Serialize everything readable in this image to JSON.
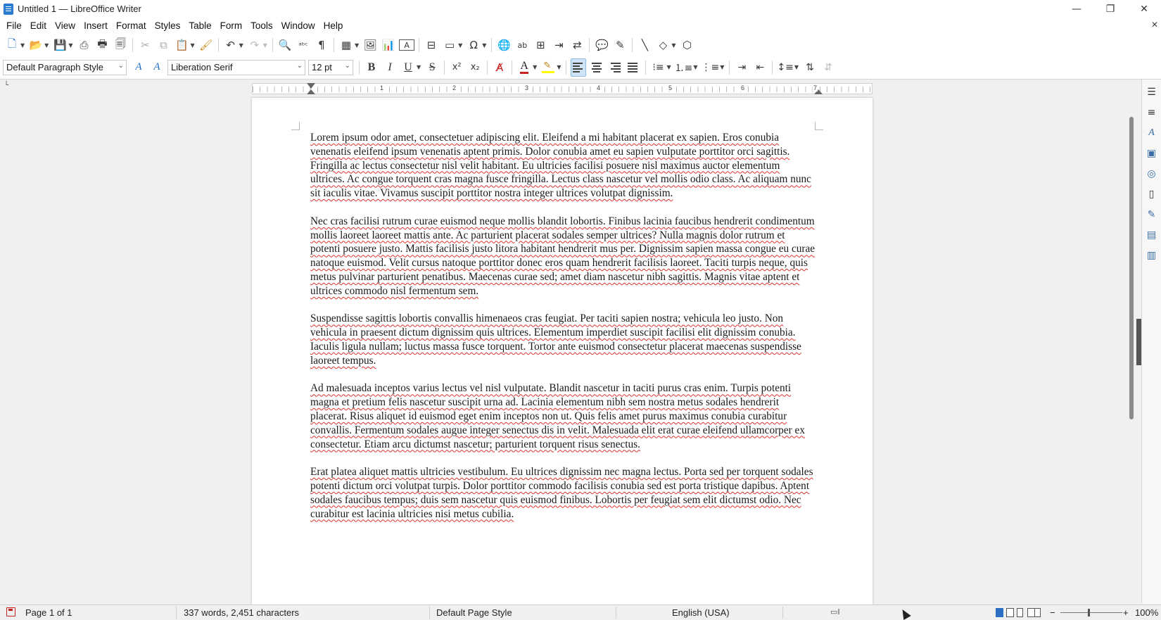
{
  "window": {
    "title": "Untitled 1 — LibreOffice Writer",
    "controls": {
      "minimize": "—",
      "restore": "❐",
      "close": "✕"
    }
  },
  "menu": {
    "items": [
      "File",
      "Edit",
      "View",
      "Insert",
      "Format",
      "Styles",
      "Table",
      "Form",
      "Tools",
      "Window",
      "Help"
    ],
    "close_doc": "✕"
  },
  "toolbar_standard": {
    "icons": {
      "new": "🗋",
      "open": "📂",
      "save": "💾",
      "export_pdf": "⎙",
      "print": "🖶",
      "print_preview": "🗐",
      "cut": "✂",
      "copy": "⧉",
      "paste": "📋",
      "clone": "🖌",
      "undo": "↶",
      "redo": "↷",
      "find_replace": "🔍",
      "spelling": "ᵃᵇᶜ",
      "formatting_marks": "¶",
      "table": "▦",
      "image": "🖼",
      "chart": "📊",
      "textbox": "A",
      "page_break": "⊟",
      "field": "▭",
      "special_char": "Ω",
      "hyperlink": "🌐",
      "footnote": "ab",
      "endnote": "⊞",
      "bookmark": "⇥",
      "cross_ref": "⇄",
      "comment": "💬",
      "track_changes": "✎",
      "line": "╲",
      "shapes": "◇",
      "draw": "⬡"
    }
  },
  "toolbar_formatting": {
    "paragraph_style": "Default Paragraph Style",
    "font_name": "Liberation Serif",
    "font_size": "12 pt",
    "bold": "B",
    "italic": "I",
    "underline": "U",
    "strikethrough": "S",
    "superscript": "x²",
    "subscript": "x₂",
    "clear_formatting": "A̸",
    "font_color": "A",
    "update_style": "A",
    "new_style": "A"
  },
  "ruler": {
    "numbers": [
      "1",
      "2",
      "3",
      "4",
      "5",
      "6",
      "7"
    ],
    "corner": "└"
  },
  "document": {
    "paragraphs": [
      "Lorem ipsum odor amet, consectetuer adipiscing elit. Eleifend a mi habitant placerat ex sapien. Eros conubia venenatis eleifend ipsum venenatis aptent primis. Dolor conubia amet eu sapien vulputate porttitor orci sagittis. Fringilla ac lectus consectetur nisl velit habitant. Eu ultricies facilisi posuere nisl maximus auctor elementum ultrices. Ac congue torquent cras magna fusce fringilla. Lectus class nascetur vel mollis odio class. Ac aliquam nunc sit iaculis vitae. Vivamus suscipit porttitor nostra integer ultrices volutpat dignissim.",
      "Nec cras facilisi rutrum curae euismod neque mollis blandit lobortis. Finibus lacinia faucibus hendrerit condimentum mollis laoreet laoreet mattis ante. Ac parturient placerat sodales semper ultrices? Nulla magnis dolor rutrum et potenti posuere justo. Mattis facilisis justo litora habitant hendrerit mus per. Dignissim sapien massa congue eu curae natoque euismod. Velit cursus natoque porttitor donec eros quam hendrerit facilisis laoreet. Taciti turpis neque, quis metus pulvinar parturient penatibus. Maecenas curae sed; amet diam nascetur nibh sagittis. Magnis vitae aptent et ultrices commodo nisl fermentum sem.",
      "Suspendisse sagittis lobortis convallis himenaeos cras feugiat. Per taciti sapien nostra; vehicula leo justo. Non vehicula in praesent dictum dignissim quis ultrices. Elementum imperdiet suscipit facilisi elit dignissim conubia. Iaculis ligula nullam; luctus massa fusce torquent. Tortor ante euismod consectetur placerat maecenas suspendisse laoreet tempus.",
      "Ad malesuada inceptos varius lectus vel nisl vulputate. Blandit nascetur in taciti purus cras enim. Turpis potenti magna et pretium felis nascetur suscipit urna ad. Lacinia elementum nibh sem nostra metus sodales hendrerit placerat. Risus aliquet id euismod eget enim inceptos non ut. Quis felis amet purus maximus conubia curabitur convallis. Fermentum sodales augue integer senectus dis in velit. Malesuada elit erat curae eleifend ullamcorper ex consectetur. Etiam arcu dictumst nascetur; parturient torquent risus senectus.",
      "Erat platea aliquet mattis ultricies vestibulum. Eu ultrices dignissim nec magna lectus. Porta sed per torquent sodales potenti dictum orci volutpat turpis. Dolor porttitor commodo facilisis conubia sed est porta tristique dapibus. Aptent sodales faucibus tempus; duis sem nascetur quis euismod finibus. Lobortis per feugiat sem elit dictumst odio. Nec curabitur est lacinia ultricies nisi metus cubilia."
    ]
  },
  "sidebar": {
    "icons": [
      "☰",
      "≡",
      "A",
      "▣",
      "◎",
      "▯",
      "✎",
      "▤",
      "▥"
    ]
  },
  "status": {
    "page": "Page 1 of 1",
    "words": "337 words, 2,451 characters",
    "page_style": "Default Page Style",
    "language": "English (USA)",
    "zoom_minus": "−",
    "zoom_plus": "+",
    "zoom_percent": "100%",
    "zoom_level": 1.0
  },
  "colors": {
    "font_color_accent": "#c9211e",
    "highlight_accent": "#ffff00",
    "spell_underline": "#e0302a"
  }
}
